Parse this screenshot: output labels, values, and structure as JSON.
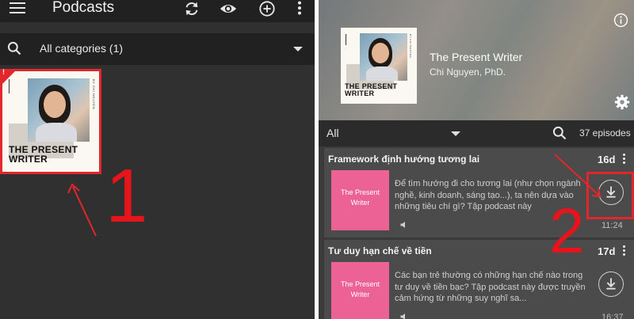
{
  "left": {
    "app_title": "Podcasts",
    "category_filter": "All categories (1)",
    "podcast_cover": {
      "title_line1": "THE PRESENT",
      "title_line2": "WRITER",
      "byline": "BY CHI NGUYEN"
    },
    "annotation_number": "1"
  },
  "right": {
    "podcast": {
      "title": "The Present Writer",
      "author": "Chi Nguyen, PhD.",
      "cover_title_line1": "THE PRESENT",
      "cover_title_line2": "WRITER",
      "cover_byline": "BY CHI NGUYEN"
    },
    "filter": {
      "selected": "All",
      "episode_count": "37 episodes"
    },
    "episodes": [
      {
        "title": "Framework định hướng tương lai",
        "age": "16d",
        "art_text": "The Present Writer",
        "description": "Để tìm hướng đi cho tương lai (như chọn ngành nghề, kinh doanh, sáng tạo...), ta nên dựa vào những tiêu chí gì? Tập podcast này",
        "duration": "11:24"
      },
      {
        "title": "Tư duy hạn chế về tiền",
        "age": "17d",
        "art_text": "The Present Writer",
        "description": "Các bạn trẻ thường có những hạn chế nào trong tư duy về tiền bạc? Tập podcast này được truyền cảm hứng từ những suy nghĩ sa...",
        "duration": "16:37"
      }
    ],
    "annotation_number": "2"
  },
  "colors": {
    "annotation_red": "#e3262c",
    "episode_art_pink": "#ec6294",
    "app_bar": "#212121"
  },
  "icons": [
    "menu-icon",
    "refresh-icon",
    "eye-icon",
    "add-icon",
    "more-vert-icon",
    "search-icon",
    "dropdown-icon",
    "info-icon",
    "gear-icon",
    "download-icon",
    "speaker-icon",
    "warning-icon"
  ]
}
